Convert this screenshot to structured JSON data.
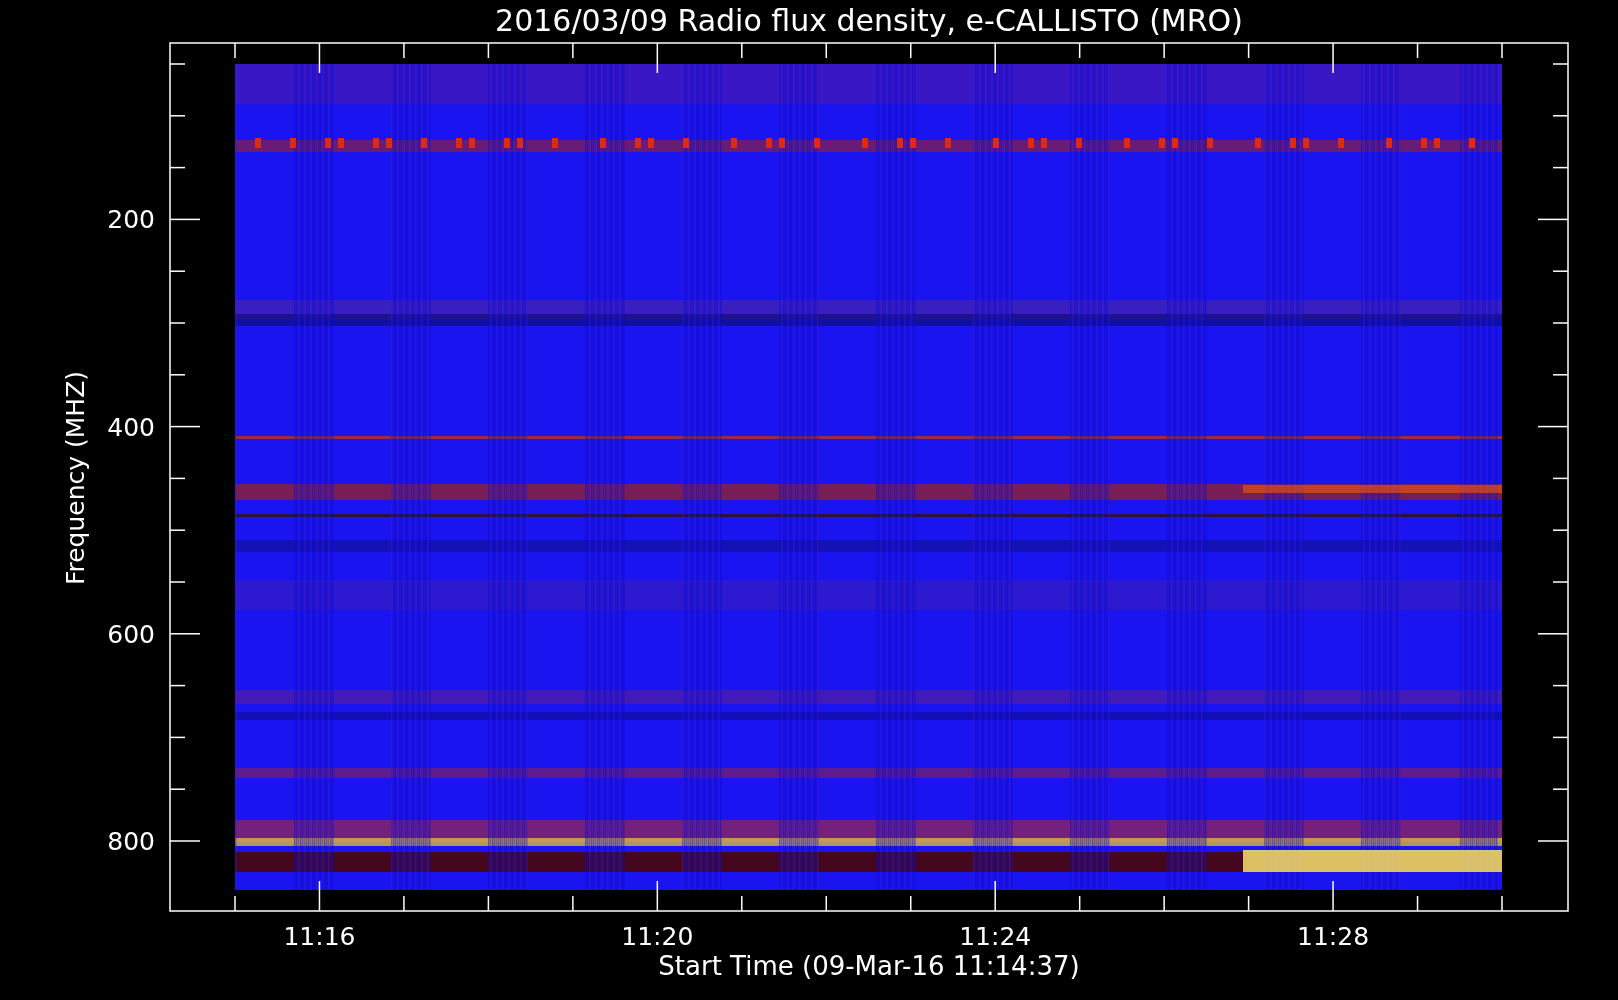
{
  "plot": {
    "title": "2016/03/09  Radio flux density, e-CALLISTO (MRO)",
    "ylabel": "Frequency (MHZ)",
    "xlabel": "Start Time (09-Mar-16 11:14:37)",
    "yticks": [
      "200",
      "400",
      "600",
      "800"
    ],
    "xticks": [
      "11:16",
      "11:20",
      "11:24",
      "11:28"
    ]
  }
}
